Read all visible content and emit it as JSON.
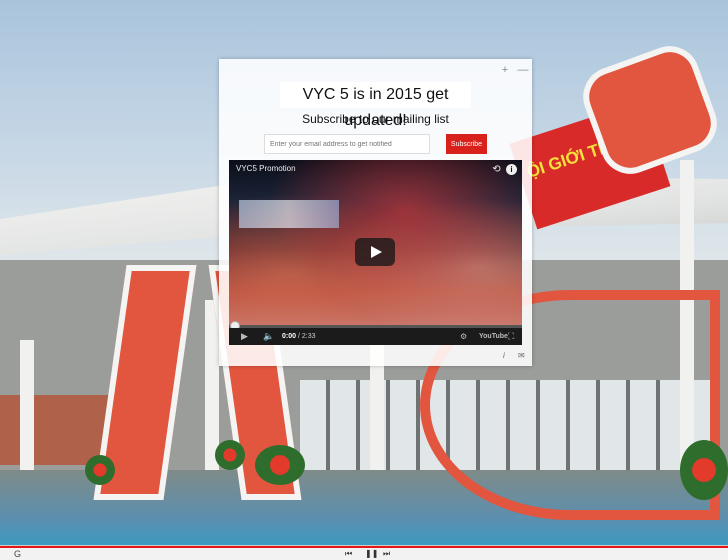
{
  "popup": {
    "headline": "VYC 5 is in 2015 get updated!",
    "subheading": "Subscribe to our mailing list",
    "email_placeholder": "Enter your email address to get notified",
    "subscribe_label": "Subscribe",
    "move_icon": "+",
    "minimize_icon": "—"
  },
  "video": {
    "title": "VYC5 Promotion",
    "current_time": "0:00",
    "duration": "/ 2:33",
    "brand": "YouTube",
    "progress": 0
  },
  "card_footer": {
    "info": "i",
    "mail": "✉"
  },
  "background": {
    "banner_text": "ỘI GIỚI TRẺ"
  },
  "bottom_bar": {
    "g_label": "G"
  },
  "colors": {
    "subscribe_red": "#d8211a",
    "progress_red": "#e01818"
  }
}
